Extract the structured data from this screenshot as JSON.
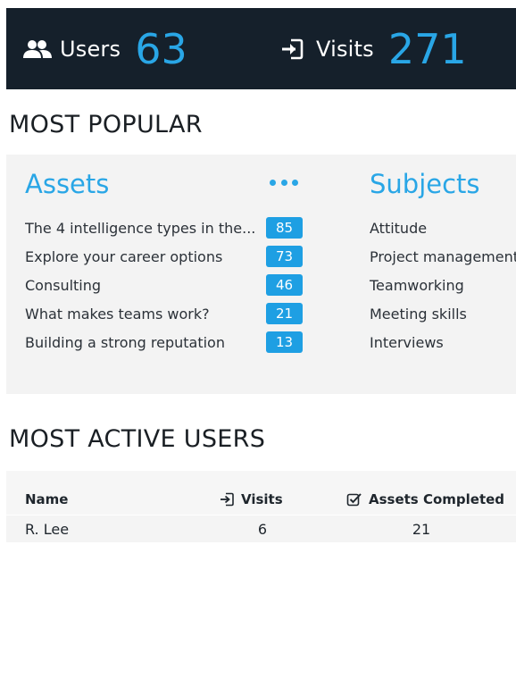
{
  "header": {
    "users": {
      "icon": "users-icon",
      "label": "Users",
      "value": "63"
    },
    "visits": {
      "icon": "sign-in-icon",
      "label": "Visits",
      "value": "271"
    }
  },
  "most_popular": {
    "title": "MOST POPULAR",
    "assets_title": "Assets",
    "more_icon": "more-dots-icon",
    "subjects_title": "Subjects",
    "assets": [
      {
        "name": "The 4 intelligence types in the...",
        "count": "85"
      },
      {
        "name": "Explore your career options",
        "count": "73"
      },
      {
        "name": "Consulting",
        "count": "46"
      },
      {
        "name": "What makes teams work?",
        "count": "21"
      },
      {
        "name": "Building a strong reputation",
        "count": "13"
      }
    ],
    "subjects": [
      "Attitude",
      "Project management",
      "Teamworking",
      "Meeting skills",
      "Interviews"
    ]
  },
  "most_active_users": {
    "title": "MOST ACTIVE USERS",
    "columns": {
      "name": "Name",
      "visits": "Visits",
      "visits_icon": "sign-in-icon",
      "assets_completed": "Assets Completed",
      "assets_icon": "checkbox-icon"
    },
    "rows": [
      {
        "name": "R. Lee",
        "visits": "6",
        "assets_completed": "21"
      }
    ]
  },
  "colors": {
    "header_bg": "#15202b",
    "accent": "#29a6e6",
    "badge": "#1e9fe3",
    "panel_bg": "#f3f3f3"
  }
}
